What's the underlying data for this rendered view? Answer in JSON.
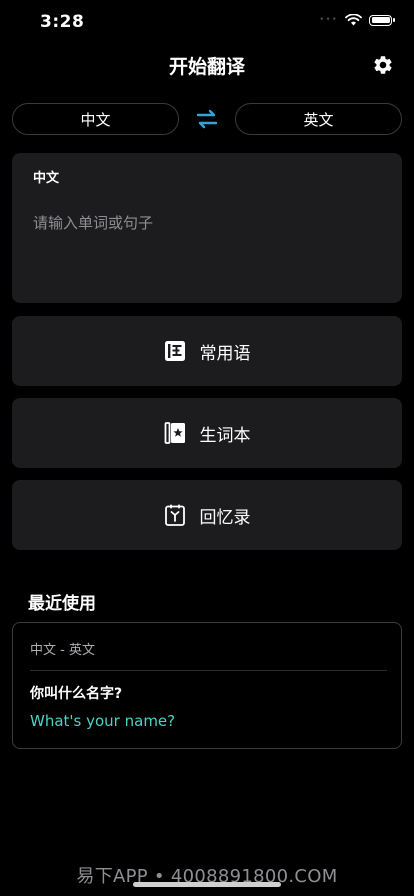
{
  "status": {
    "time": "3:28",
    "signal": "•••"
  },
  "header": {
    "title": "开始翻译",
    "settings_icon": "gear-icon"
  },
  "languages": {
    "source": "中文",
    "target": "英文",
    "swap_icon": "swap-arrows-icon"
  },
  "input": {
    "language_label": "中文",
    "placeholder": "请输入单词或句子",
    "value": ""
  },
  "actions": [
    {
      "label": "常用语",
      "icon": "phrasebook-icon"
    },
    {
      "label": "生词本",
      "icon": "vocabulary-book-icon"
    },
    {
      "label": "回忆录",
      "icon": "memo-icon"
    }
  ],
  "recent": {
    "title": "最近使用",
    "items": [
      {
        "pair": "中文 - 英文",
        "source": "你叫什么名字?",
        "target": "What's your name?"
      }
    ]
  },
  "watermark": "易下APP • 4008891800.COM",
  "colors": {
    "background": "#000000",
    "card": "#1c1c1e",
    "accent_teal": "#4fd1c5",
    "swap_blue": "#31a5d8"
  }
}
